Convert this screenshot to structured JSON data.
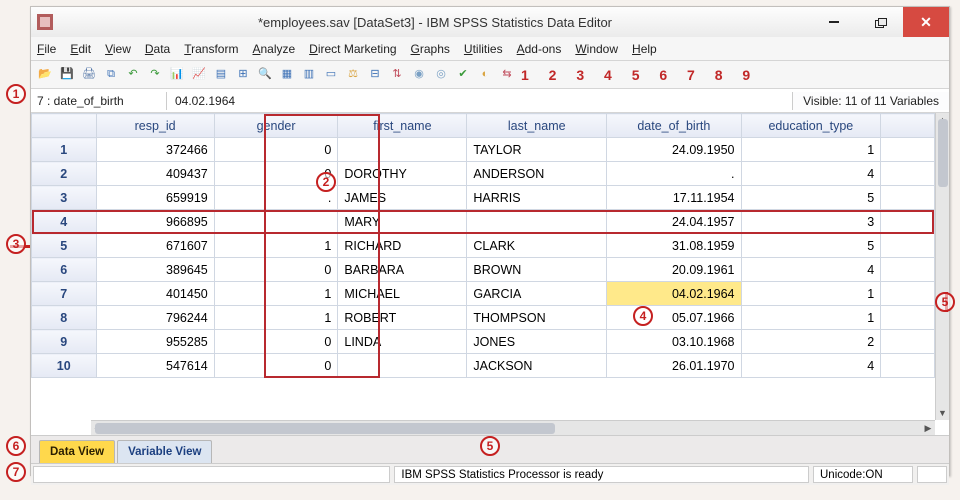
{
  "title": "*employees.sav [DataSet3] - IBM SPSS Statistics Data Editor",
  "menu": [
    "File",
    "Edit",
    "View",
    "Data",
    "Transform",
    "Analyze",
    "Direct Marketing",
    "Graphs",
    "Utilities",
    "Add-ons",
    "Window",
    "Help"
  ],
  "cellref": {
    "name": "7 : date_of_birth",
    "value": "04.02.1964"
  },
  "visible": "Visible: 11 of 11 Variables",
  "columns": [
    "resp_id",
    "gender",
    "first_name",
    "last_name",
    "date_of_birth",
    "education_type"
  ],
  "rows": [
    {
      "n": "1",
      "resp_id": "372466",
      "gender": "0",
      "first_name": "",
      "last_name": "TAYLOR",
      "date_of_birth": "24.09.1950",
      "education_type": "1"
    },
    {
      "n": "2",
      "resp_id": "409437",
      "gender": "0",
      "first_name": "DOROTHY",
      "last_name": "ANDERSON",
      "date_of_birth": ".",
      "education_type": "4"
    },
    {
      "n": "3",
      "resp_id": "659919",
      "gender": ".",
      "first_name": "JAMES",
      "last_name": "HARRIS",
      "date_of_birth": "17.11.1954",
      "education_type": "5"
    },
    {
      "n": "4",
      "resp_id": "966895",
      "gender": "",
      "first_name": "MARY",
      "last_name": "",
      "date_of_birth": "24.04.1957",
      "education_type": "3"
    },
    {
      "n": "5",
      "resp_id": "671607",
      "gender": "1",
      "first_name": "RICHARD",
      "last_name": "CLARK",
      "date_of_birth": "31.08.1959",
      "education_type": "5"
    },
    {
      "n": "6",
      "resp_id": "389645",
      "gender": "0",
      "first_name": "BARBARA",
      "last_name": "BROWN",
      "date_of_birth": "20.09.1961",
      "education_type": "4"
    },
    {
      "n": "7",
      "resp_id": "401450",
      "gender": "1",
      "first_name": "MICHAEL",
      "last_name": "GARCIA",
      "date_of_birth": "04.02.1964",
      "education_type": "1"
    },
    {
      "n": "8",
      "resp_id": "796244",
      "gender": "1",
      "first_name": "ROBERT",
      "last_name": "THOMPSON",
      "date_of_birth": "05.07.1966",
      "education_type": "1"
    },
    {
      "n": "9",
      "resp_id": "955285",
      "gender": "0",
      "first_name": "LINDA",
      "last_name": "JONES",
      "date_of_birth": "03.10.1968",
      "education_type": "2"
    },
    {
      "n": "10",
      "resp_id": "547614",
      "gender": "0",
      "first_name": "",
      "last_name": "JACKSON",
      "date_of_birth": "26.01.1970",
      "education_type": "4"
    }
  ],
  "tabs": {
    "data": "Data View",
    "variable": "Variable View"
  },
  "status": {
    "processor": "IBM SPSS Statistics Processor is ready",
    "unicode": "Unicode:ON"
  },
  "toolbar_extra_numbers": "1 2 3 4 5 6 7 8 9",
  "callouts": {
    "c1": "1",
    "c2": "2",
    "c3": "3",
    "c4": "4",
    "c5": "5",
    "c6": "6",
    "c7": "7"
  },
  "toolbar_icons": [
    {
      "name": "open-icon",
      "glyph": "📂",
      "color": "#d9a441"
    },
    {
      "name": "save-icon",
      "glyph": "💾",
      "color": "#3a6fb5"
    },
    {
      "name": "print-icon",
      "glyph": "🖨",
      "color": "#4a6fa3"
    },
    {
      "name": "recall-dialog-icon",
      "glyph": "⧉",
      "color": "#3a6fb5"
    },
    {
      "name": "undo-icon",
      "glyph": "↶",
      "color": "#3a9a3a"
    },
    {
      "name": "redo-icon",
      "glyph": "↷",
      "color": "#3a9a3a"
    },
    {
      "name": "goto-case-icon",
      "glyph": "📊",
      "color": "#3a6fb5"
    },
    {
      "name": "goto-variable-icon",
      "glyph": "📈",
      "color": "#3a6fb5"
    },
    {
      "name": "variables-icon",
      "glyph": "▤",
      "color": "#3a6fb5"
    },
    {
      "name": "run-descriptives-icon",
      "glyph": "⊞",
      "color": "#3a6fb5"
    },
    {
      "name": "find-icon",
      "glyph": "🔍",
      "color": "#6b4f3a"
    },
    {
      "name": "insert-cases-icon",
      "glyph": "▦",
      "color": "#3a6fb5"
    },
    {
      "name": "insert-variable-icon",
      "glyph": "▥",
      "color": "#3a6fb5"
    },
    {
      "name": "split-file-icon",
      "glyph": "▭",
      "color": "#3a6fb5"
    },
    {
      "name": "weight-cases-icon",
      "glyph": "⚖",
      "color": "#d9a441"
    },
    {
      "name": "select-cases-icon",
      "glyph": "⊟",
      "color": "#3a6fb5"
    },
    {
      "name": "value-labels-icon",
      "glyph": "⇅",
      "color": "#c04a5a"
    },
    {
      "name": "use-variable-sets-icon",
      "glyph": "◉",
      "color": "#7aa0c4"
    },
    {
      "name": "show-all-variables-icon",
      "glyph": "◎",
      "color": "#7aa0c4"
    },
    {
      "name": "spell-check-icon",
      "glyph": "✔",
      "color": "#3a9a3a"
    },
    {
      "name": "customize-toolbar-icon",
      "glyph": "◐",
      "color": "#d9a441"
    },
    {
      "name": "toggle-value-labels-icon",
      "glyph": "⇆",
      "color": "#c04a5a"
    }
  ]
}
